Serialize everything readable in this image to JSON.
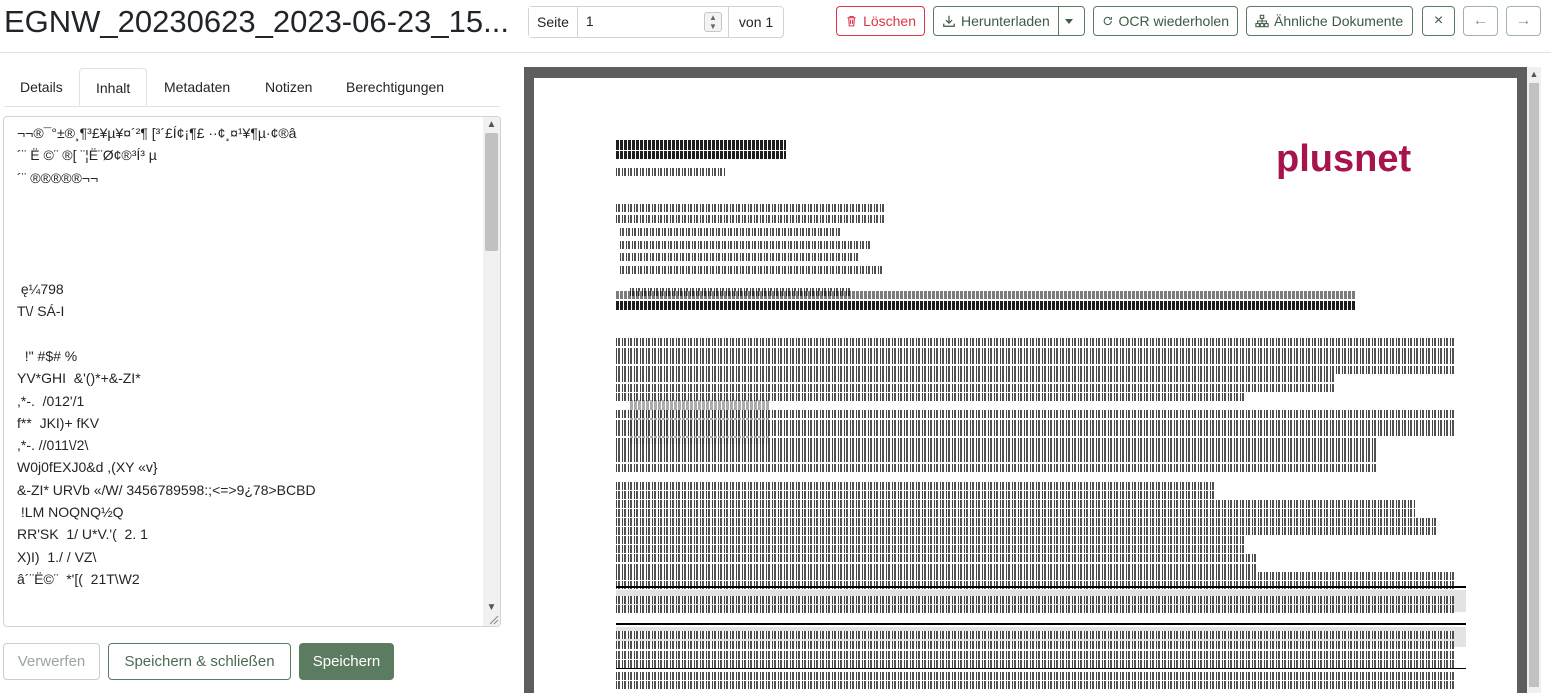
{
  "header": {
    "title": "EGNW_20230623_2023-06-23_15...",
    "pager": {
      "label": "Seite",
      "value": "1",
      "of_label": "von 1"
    },
    "buttons": {
      "delete": "Löschen",
      "download": "Herunterladen",
      "ocr": "OCR wiederholen",
      "similar": "Ähnliche Dokumente",
      "close": "×",
      "prev": "←",
      "next": "→"
    }
  },
  "tabs": [
    {
      "label": "Details"
    },
    {
      "label": "Inhalt",
      "active": true
    },
    {
      "label": "Metadaten"
    },
    {
      "label": "Notizen"
    },
    {
      "label": "Berechtigungen"
    }
  ],
  "content": {
    "text": "¬¬®¯°±®¸¶³£¥µ¥¤´²¶ [³´£Í¢¡¶£ ··¢¸¤¹¥¶µ·¢®â\n´¨ Ë ©¨ ®[ ¨¦Ë¨Ø¢®³Í³ µ\n´¨ ®®®®®¬¬\n\n\n\n\n ę¼798 \nT\\/ SÁ-I\n\n  !\" #$# %  \nYV*GHI  &'()*+&-ZI*\n,*-.  /012'/1 \nf**  JKI)+ fKV\n,*-. //011\\/2\\\nW0j0fEXJ0&d ,(XY «v}\n&-ZI* URVb «/W/ 3456789598:;<=>9¿78>BCBD\n !LM NOQNQ½Q\nRR'SK  1/ U*V.'(  2. 1\nX)I)  1./ / VZ\\\nâ´¨Ë©¨  *'[(  21T\\W2"
  },
  "footer": {
    "discard": "Verwerfen",
    "save_close": "Speichern & schließen",
    "save": "Speichern"
  },
  "preview": {
    "logo": "plusnet"
  },
  "colors": {
    "accent": "#5b7c61",
    "danger": "#dc3545",
    "brand_logo": "#a7134c",
    "preview_bg": "#5e5e5e"
  }
}
